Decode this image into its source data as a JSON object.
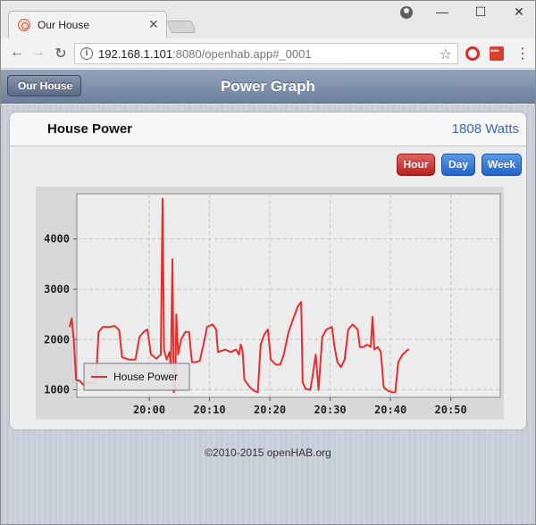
{
  "browser": {
    "tab_title": "Our House",
    "tab_close": "✕",
    "url_host": "192.168.1.101",
    "url_rest": ":8080/openhab.app#_0001",
    "win_minimize": "—",
    "win_maximize": "☐",
    "win_close": "✕",
    "back_glyph": "←",
    "forward_glyph": "→",
    "reload_glyph": "↻",
    "star_glyph": "☆",
    "menu_glyph": "⋮",
    "info_glyph": "i"
  },
  "header": {
    "back_label": "Our House",
    "title": "Power Graph"
  },
  "item": {
    "label": "House Power",
    "value": "1808 Watts"
  },
  "period_buttons": {
    "hour": "Hour",
    "day": "Day",
    "week": "Week"
  },
  "colors": {
    "series": "#e03030",
    "active_button": "#c0302b",
    "inactive_button": "#2f6fd0",
    "value_text": "#3a6aa8"
  },
  "chart_data": {
    "type": "line",
    "xlim": [
      19.8,
      20.97
    ],
    "ylim": [
      850,
      4900
    ],
    "x_ticks": [
      20.0,
      20.1667,
      20.3333,
      20.5,
      20.6667,
      20.8333
    ],
    "x_tick_labels": [
      "20:00",
      "20:10",
      "20:20",
      "20:30",
      "20:40",
      "20:50"
    ],
    "y_ticks": [
      1000,
      2000,
      3000,
      4000
    ],
    "y_tick_labels": [
      "1000",
      "2000",
      "3000",
      "4000"
    ],
    "grid": true,
    "legend": "bottom-left",
    "series": [
      {
        "name": "House Power",
        "points": [
          [
            19.78,
            2250
          ],
          [
            19.786,
            2420
          ],
          [
            19.792,
            1950
          ],
          [
            19.798,
            1200
          ],
          [
            19.808,
            1180
          ],
          [
            19.817,
            1100
          ],
          [
            19.83,
            1150
          ],
          [
            19.843,
            1120
          ],
          [
            19.853,
            1150
          ],
          [
            19.86,
            2150
          ],
          [
            19.872,
            2250
          ],
          [
            19.89,
            2250
          ],
          [
            19.905,
            2270
          ],
          [
            19.917,
            2190
          ],
          [
            19.925,
            1650
          ],
          [
            19.945,
            1600
          ],
          [
            19.962,
            1600
          ],
          [
            19.973,
            2050
          ],
          [
            19.985,
            2150
          ],
          [
            19.995,
            2200
          ],
          [
            20.005,
            1700
          ],
          [
            20.02,
            1620
          ],
          [
            20.032,
            1700
          ],
          [
            20.037,
            4800
          ],
          [
            20.041,
            1800
          ],
          [
            20.048,
            1600
          ],
          [
            20.056,
            1750
          ],
          [
            20.06,
            1450
          ],
          [
            20.064,
            3600
          ],
          [
            20.068,
            950
          ],
          [
            20.072,
            1100
          ],
          [
            20.075,
            2500
          ],
          [
            20.08,
            1700
          ],
          [
            20.088,
            2000
          ],
          [
            20.1,
            2150
          ],
          [
            20.11,
            2150
          ],
          [
            20.118,
            1550
          ],
          [
            20.13,
            1550
          ],
          [
            20.14,
            1580
          ],
          [
            20.15,
            1900
          ],
          [
            20.16,
            2250
          ],
          [
            20.175,
            2300
          ],
          [
            20.185,
            2200
          ],
          [
            20.19,
            1750
          ],
          [
            20.21,
            1800
          ],
          [
            20.225,
            1750
          ],
          [
            20.24,
            1800
          ],
          [
            20.248,
            1700
          ],
          [
            20.253,
            1900
          ],
          [
            20.258,
            1780
          ],
          [
            20.263,
            1200
          ],
          [
            20.278,
            1050
          ],
          [
            20.29,
            980
          ],
          [
            20.3,
            950
          ],
          [
            20.308,
            1900
          ],
          [
            20.318,
            2100
          ],
          [
            20.328,
            2200
          ],
          [
            20.336,
            1600
          ],
          [
            20.35,
            1500
          ],
          [
            20.362,
            1500
          ],
          [
            20.372,
            1700
          ],
          [
            20.385,
            2150
          ],
          [
            20.4,
            2450
          ],
          [
            20.41,
            2650
          ],
          [
            20.42,
            2750
          ],
          [
            20.424,
            1150
          ],
          [
            20.432,
            1020
          ],
          [
            20.445,
            1000
          ],
          [
            20.45,
            1200
          ],
          [
            20.46,
            1700
          ],
          [
            20.468,
            1000
          ],
          [
            20.478,
            2050
          ],
          [
            20.49,
            2200
          ],
          [
            20.505,
            2250
          ],
          [
            20.512,
            1850
          ],
          [
            20.52,
            1550
          ],
          [
            20.53,
            1450
          ],
          [
            20.54,
            1600
          ],
          [
            20.55,
            2200
          ],
          [
            20.562,
            2300
          ],
          [
            20.576,
            2200
          ],
          [
            20.582,
            1850
          ],
          [
            20.592,
            1850
          ],
          [
            20.602,
            1900
          ],
          [
            20.612,
            1850
          ],
          [
            20.617,
            2450
          ],
          [
            20.622,
            1800
          ],
          [
            20.632,
            1850
          ],
          [
            20.64,
            1750
          ],
          [
            20.648,
            1050
          ],
          [
            20.66,
            980
          ],
          [
            20.672,
            950
          ],
          [
            20.68,
            950
          ],
          [
            20.688,
            1550
          ],
          [
            20.7,
            1700
          ],
          [
            20.712,
            1780
          ],
          [
            20.718,
            1808
          ]
        ]
      }
    ]
  },
  "footer": {
    "text": "©2010-2015 openHAB.org"
  }
}
